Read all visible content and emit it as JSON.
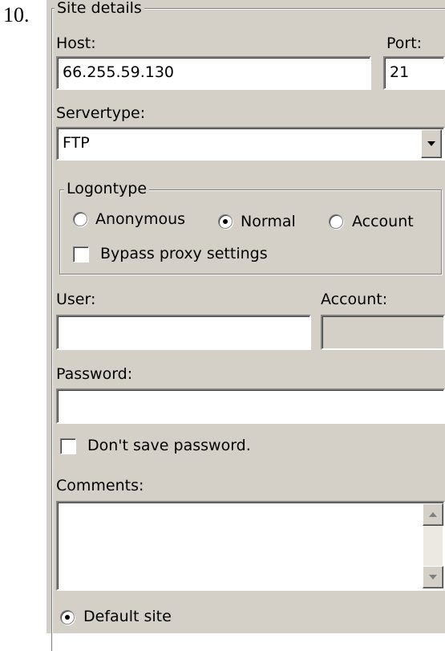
{
  "step_number": "10.",
  "site_details": {
    "group_label": "Site details",
    "host_label": "Host:",
    "host_value": "66.255.59.130",
    "port_label": "Port:",
    "port_value": "21",
    "servertype_label": "Servertype:",
    "servertype_value": "FTP",
    "logontype": {
      "group_label": "Logontype",
      "options": [
        "Anonymous",
        "Normal",
        "Account"
      ],
      "selected": "Normal",
      "bypass_label": "Bypass proxy settings",
      "bypass_checked": false
    },
    "user_label": "User:",
    "user_value": "",
    "account_label": "Account:",
    "account_value": "",
    "password_label": "Password:",
    "password_value": "",
    "dont_save_label": "Don't save password.",
    "dont_save_checked": false,
    "comments_label": "Comments:",
    "comments_value": "",
    "default_site_label": "Default site",
    "default_site_selected": true
  }
}
